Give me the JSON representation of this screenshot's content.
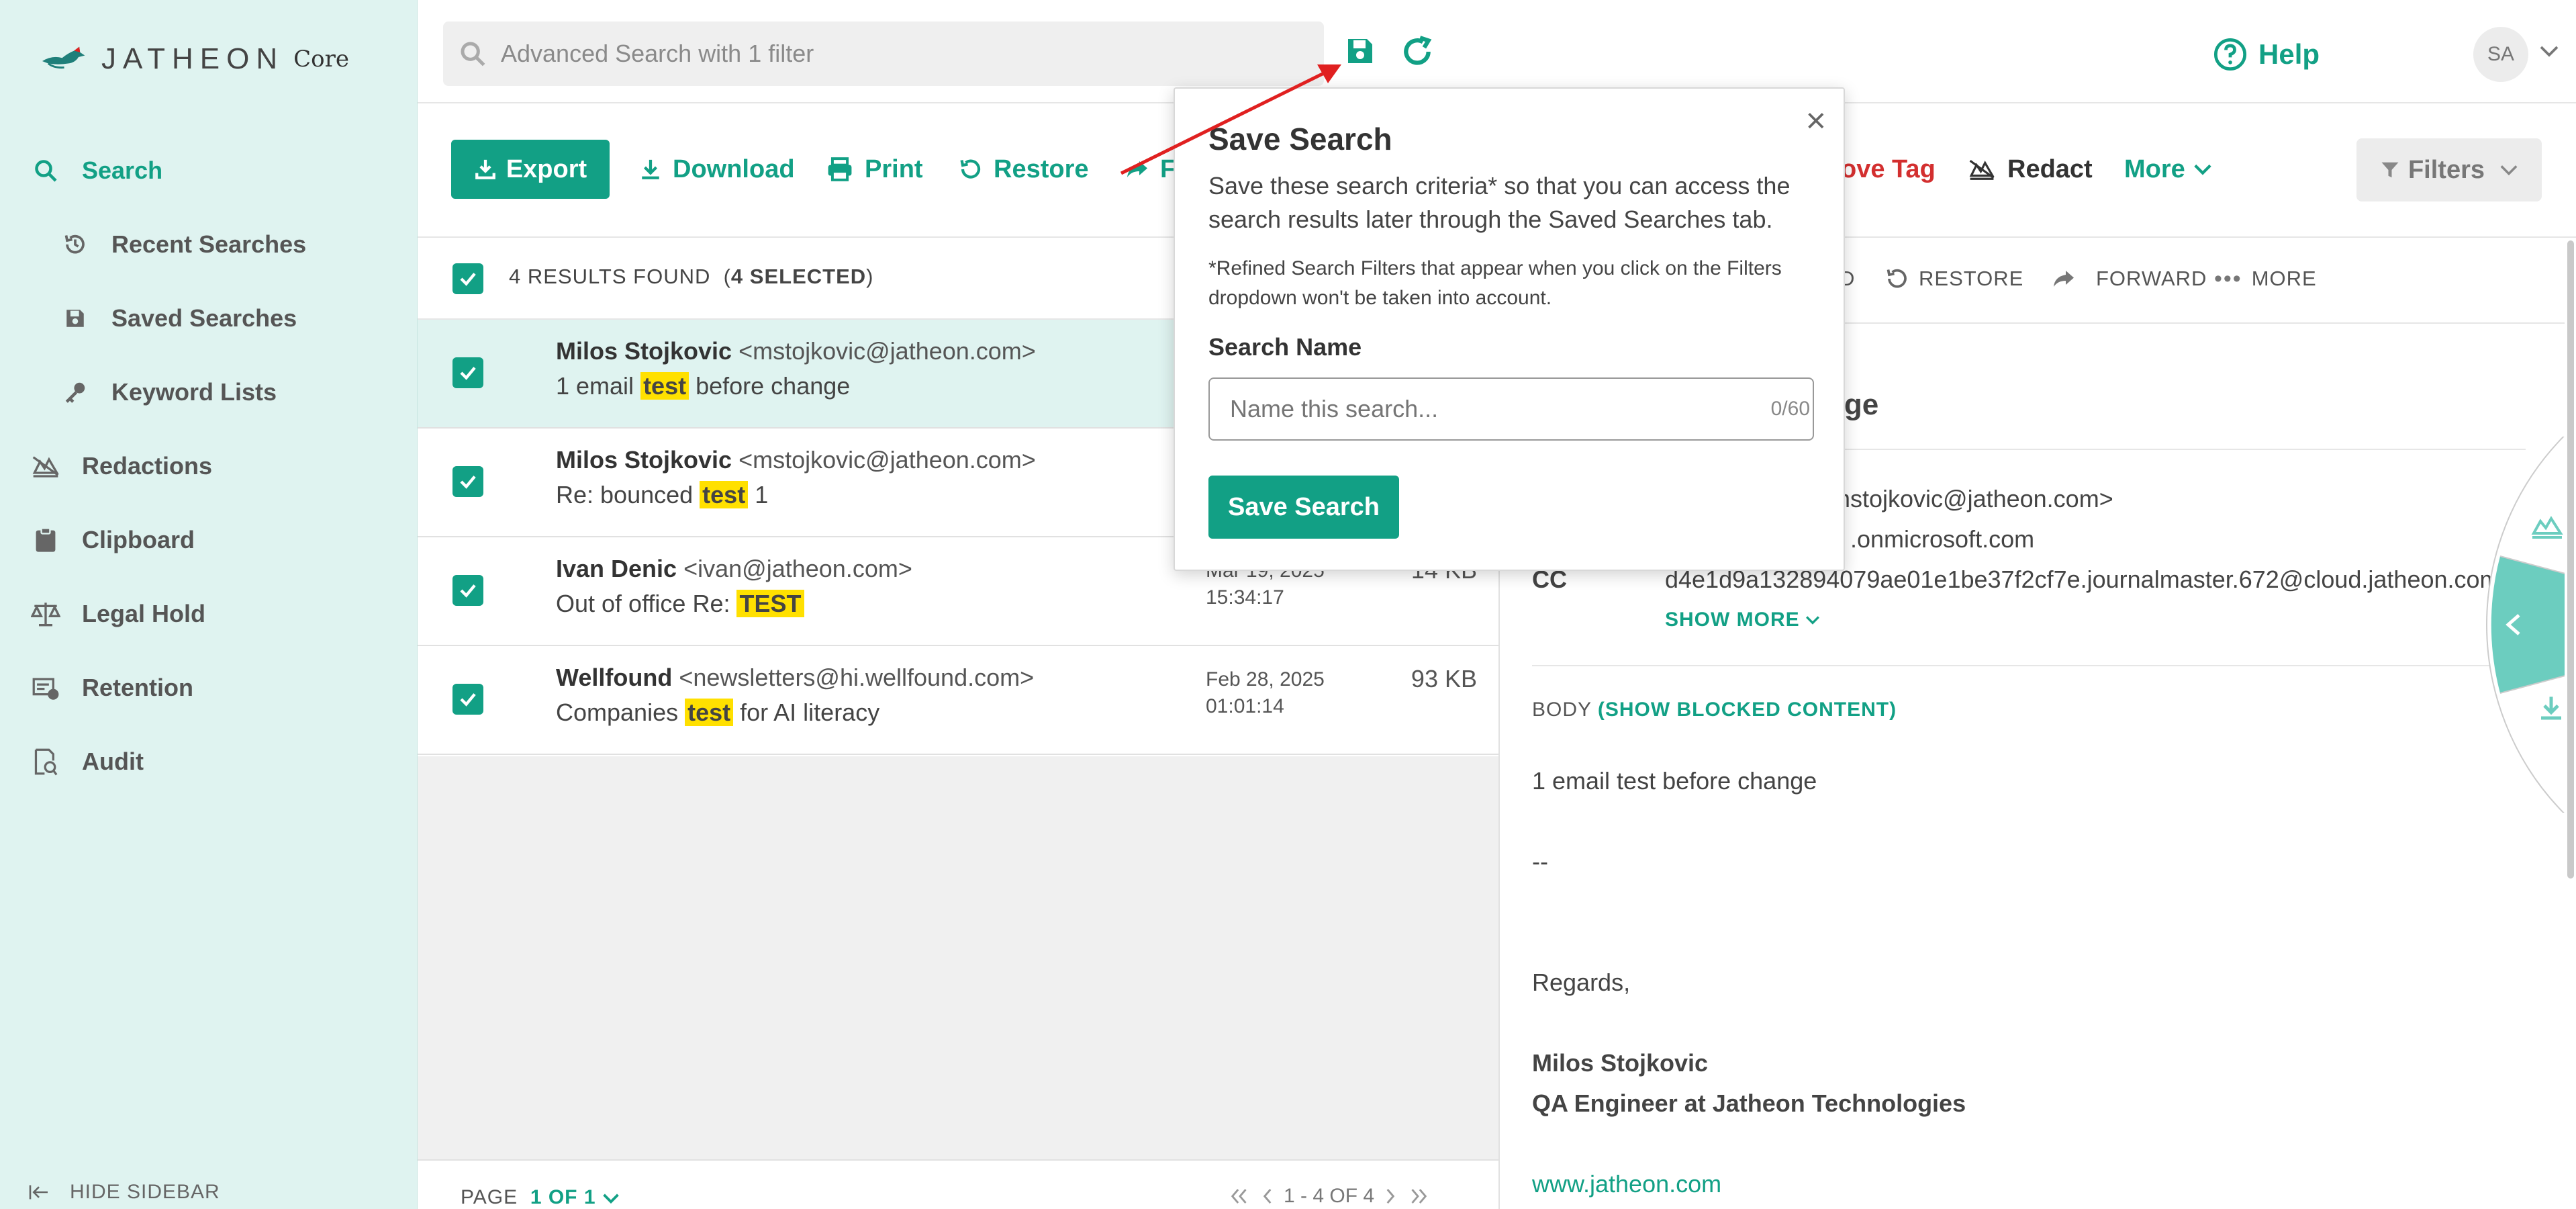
{
  "app": {
    "logo_text": "JATHEON",
    "logo_suffix": "Core"
  },
  "sidebar": {
    "items": [
      {
        "label": "Search",
        "icon": "search-icon"
      },
      {
        "label": "Recent Searches",
        "icon": "history-icon"
      },
      {
        "label": "Saved Searches",
        "icon": "save-icon"
      },
      {
        "label": "Keyword Lists",
        "icon": "key-icon"
      },
      {
        "label": "Redactions",
        "icon": "redact-icon"
      },
      {
        "label": "Clipboard",
        "icon": "clipboard-icon"
      },
      {
        "label": "Legal Hold",
        "icon": "scale-icon"
      },
      {
        "label": "Retention",
        "icon": "retention-icon"
      },
      {
        "label": "Audit",
        "icon": "audit-icon"
      }
    ],
    "hide_label": "HIDE SIDEBAR"
  },
  "topbar": {
    "search_placeholder": "Advanced Search with 1 filter",
    "help_label": "Help",
    "avatar_initials": "SA"
  },
  "toolbar": {
    "export": "Export",
    "download": "Download",
    "print": "Print",
    "restore": "Restore",
    "forward_partial": "F",
    "remove_tag_partial": "ove Tag",
    "redact": "Redact",
    "more": "More",
    "filters": "Filters"
  },
  "results": {
    "count_text": "4 RESULTS FOUND",
    "selected_text": "4 SELECTED",
    "rows": [
      {
        "name": "Milos Stojkovic",
        "email": "<mstojkovic@jatheon.com>",
        "subject_before": "1 email ",
        "highlight": "test",
        "subject_after": " before change",
        "date": "",
        "time": "",
        "size": ""
      },
      {
        "name": "Milos Stojkovic",
        "email": "<mstojkovic@jatheon.com>",
        "subject_before": "Re: bounced ",
        "highlight": "test",
        "subject_after": " 1",
        "date": "",
        "time": "",
        "size": ""
      },
      {
        "name": "Ivan Denic",
        "email": "<ivan@jatheon.com>",
        "subject_before": "Out of office Re: ",
        "highlight": "TEST",
        "subject_after": "",
        "date": "Mar 19, 2025",
        "time": "15:34:17",
        "size": "14 KB"
      },
      {
        "name": "Wellfound",
        "email": "<newsletters@hi.wellfound.com>",
        "subject_before": "Companies ",
        "highlight": "test",
        "subject_after": " for AI literacy",
        "date": "Feb 28, 2025",
        "time": "01:01:14",
        "size": "93 KB"
      }
    ],
    "pager_label": "PAGE",
    "pager_value": "1 OF 1",
    "pager_range": "1 - 4 OF 4"
  },
  "preview": {
    "actions": {
      "partial": "D",
      "restore": "RESTORE",
      "forward": "FORWARD",
      "more": "MORE"
    },
    "title_partial": "nge",
    "from_partial": "mstojkovic@jatheon.com>",
    "to_partial": ".onmicrosoft.com",
    "cc_label": "CC",
    "cc_value": "d4e1d9a132894079ae01e1be37f2cf7e.journalmaster.672@cloud.jatheon.com",
    "show_more": "SHOW MORE",
    "body_label": "BODY",
    "blocked_link": "(SHOW BLOCKED CONTENT)",
    "body_line1": "1 email test before change",
    "body_dash": "--",
    "regards": "Regards,",
    "sig_name": "Milos Stojkovic",
    "sig_title": "QA Engineer at Jatheon Technologies",
    "sig_link": "www.jatheon.com"
  },
  "popup": {
    "title": "Save Search",
    "close": "×",
    "description": "Save these search criteria* so that you can access the search results later through the Saved Searches tab.",
    "note": "*Refined Search Filters that appear when you click on the Filters dropdown won't be taken into account.",
    "name_label": "Search Name",
    "name_placeholder": "Name this search...",
    "counter": "0/60",
    "save_button": "Save Search"
  },
  "colors": {
    "accent": "#12a085",
    "sidebar_bg": "#dff3f0",
    "highlight": "#ffe000",
    "annotation": "#e02020",
    "danger": "#d32f2f"
  }
}
